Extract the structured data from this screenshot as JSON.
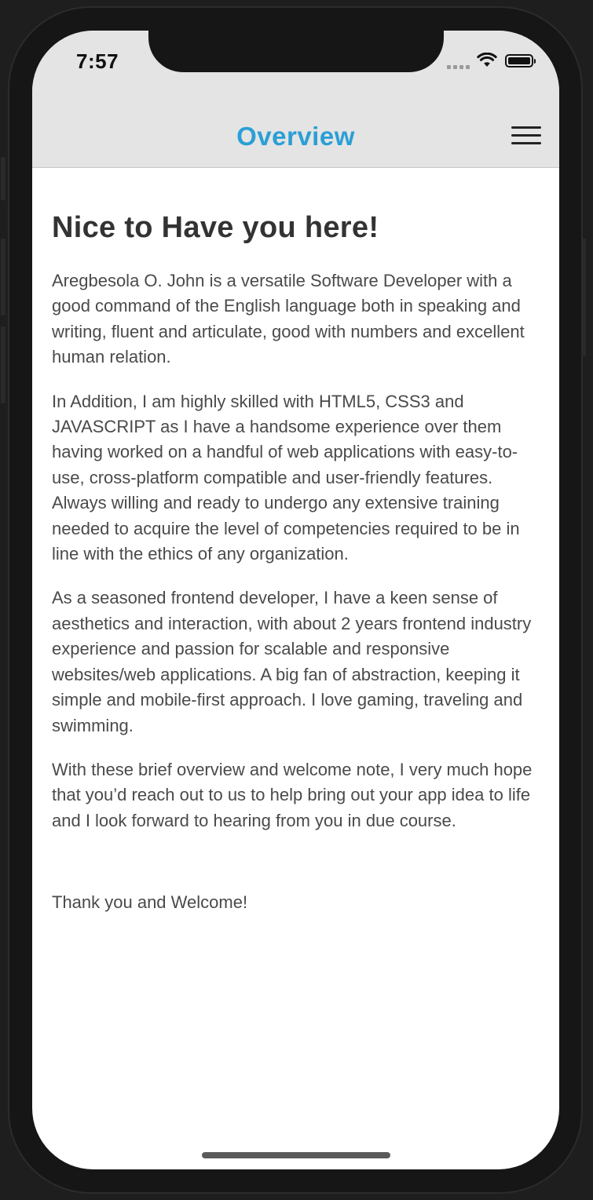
{
  "status_bar": {
    "time": "7:57"
  },
  "nav": {
    "title": "Overview",
    "title_color": "#2a9fd6",
    "menu_icon": "hamburger-menu-icon"
  },
  "content": {
    "heading": "Nice to Have you here!",
    "paragraphs": [
      "Aregbesola O. John is a versatile Software Developer with a good command of the English language both in speaking and writing, fluent and articulate, good with numbers and excellent human relation.",
      "In Addition, I am highly skilled with HTML5, CSS3 and JAVASCRIPT as I have a handsome experience over them having worked on a handful of web applications with easy-to-use, cross-platform compatible and user-friendly features. Always willing and ready to undergo any extensive training needed to acquire the level of competencies required to be in line with the ethics of any organization.",
      "As a seasoned frontend developer, I have a keen sense of aesthetics and interaction, with about 2 years frontend industry experience and passion for scalable and responsive websites/web applications. A big fan of abstraction, keeping it simple and mobile-first approach. I love gaming, traveling and swimming.",
      "With these brief overview and welcome note, I very much hope that you’d reach out to us to help bring out your app idea to life and I look forward to hearing from you in due course."
    ],
    "closing": "Thank you and Welcome!"
  }
}
